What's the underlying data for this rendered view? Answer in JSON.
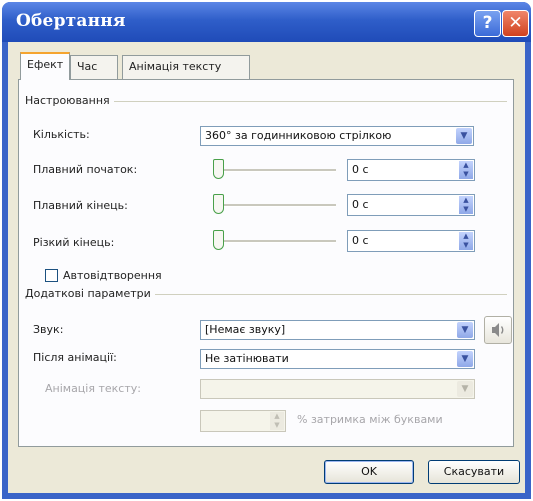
{
  "window": {
    "title": "Обертання",
    "help_glyph": "?",
    "close_glyph": "✕"
  },
  "tabs": [
    {
      "label": "Ефект",
      "active": true
    },
    {
      "label": "Час",
      "active": false
    },
    {
      "label": "Анімація тексту",
      "active": false
    }
  ],
  "settings": {
    "group_label": "Настроювання",
    "quantity_label": "Кількість:",
    "quantity_value": "360° за годинниковою стрілкою",
    "smooth_start_label": "Плавний початок:",
    "smooth_start_value": "0 с",
    "smooth_end_label": "Плавний кінець:",
    "smooth_end_value": "0 с",
    "sharp_end_label": "Різкий кінець:",
    "sharp_end_value": "0 с",
    "autoreverse_label": "Автовідтворення",
    "autoreverse_checked": false
  },
  "extra": {
    "group_label": "Додаткові параметри",
    "sound_label": "Звук:",
    "sound_value": "[Немає звуку]",
    "after_label": "Після анімації:",
    "after_value": "Не затінювати",
    "text_anim_label": "Анімація тексту:",
    "text_anim_value": "",
    "delay_value": "",
    "delay_suffix": "% затримка між буквами"
  },
  "buttons": {
    "ok": "OK",
    "cancel": "Скасувати"
  },
  "icons": {
    "dropdown": "▼",
    "spin_up": "▲",
    "spin_down": "▼",
    "speaker": "speaker-icon"
  },
  "colors": {
    "title_bar": "#2f5ec9",
    "tab_highlight": "#f5a42f",
    "close": "#d0411e",
    "dialog_bg": "#ece9d8"
  }
}
